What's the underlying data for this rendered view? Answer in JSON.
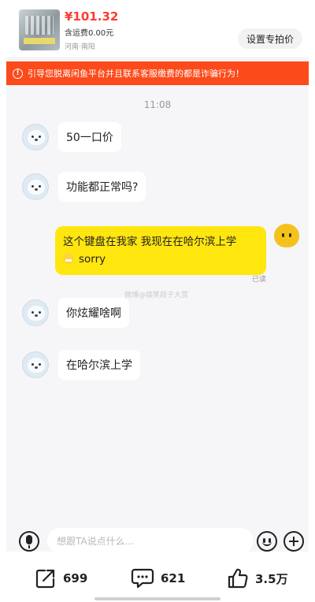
{
  "product": {
    "price": "¥101.32",
    "shipping": "含运费0.00元",
    "location": "河南·南阳",
    "set_price_label": "设置专拍价"
  },
  "warning": {
    "icon": "exclamation-circle-icon",
    "text": "引导您脱离闲鱼平台并且联系客服缴费的都是诈骗行为！"
  },
  "chat": {
    "time": "11:08",
    "messages": [
      {
        "from": "other",
        "text": "50一口价"
      },
      {
        "from": "other",
        "text": "功能都正常吗?"
      },
      {
        "from": "me",
        "line1": "这个键盘在我家 我现在在哈尔滨上学",
        "line2": "sorry",
        "status": "已读"
      },
      {
        "from": "other",
        "text": "你炫耀啥啊"
      },
      {
        "from": "other",
        "text": "在哈尔滨上学"
      }
    ],
    "watermark": "微博@搞笑段子大赏"
  },
  "input": {
    "placeholder": "想跟TA说点什么..."
  },
  "actions": {
    "share_count": "699",
    "comment_count": "621",
    "like_count": "3.5万"
  },
  "colors": {
    "accent_red": "#fc4a1a",
    "price_red": "#ff3b2f",
    "my_bubble": "#ffe60f"
  }
}
